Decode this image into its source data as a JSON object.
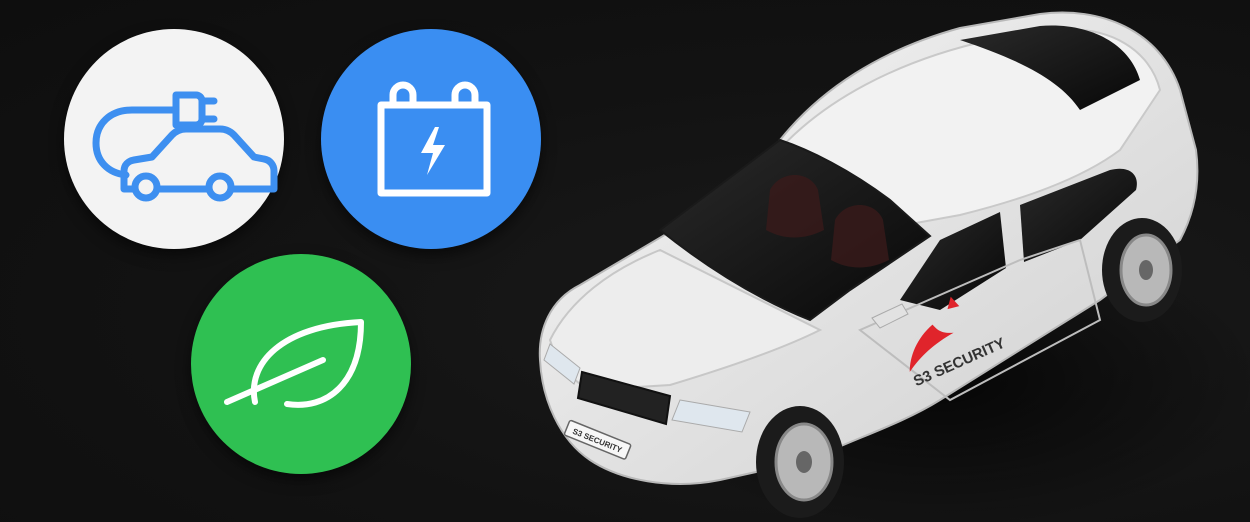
{
  "colors": {
    "background": "#121212",
    "ev_badge_fill": "#f4f4f4",
    "ev_icon_stroke": "#3d8ff0",
    "battery_badge_fill": "#3a8ef2",
    "leaf_badge_fill": "#2fc052",
    "icon_white": "#ffffff",
    "car_body": "#e9e9e9",
    "logo_red": "#e0242b"
  },
  "badges": [
    {
      "icon": "ev-charging-car-icon"
    },
    {
      "icon": "battery-bolt-icon"
    },
    {
      "icon": "leaf-eco-icon"
    }
  ],
  "car": {
    "door_logo_text": "S3 SECURITY",
    "plate_text": "S3 SECURITY"
  }
}
